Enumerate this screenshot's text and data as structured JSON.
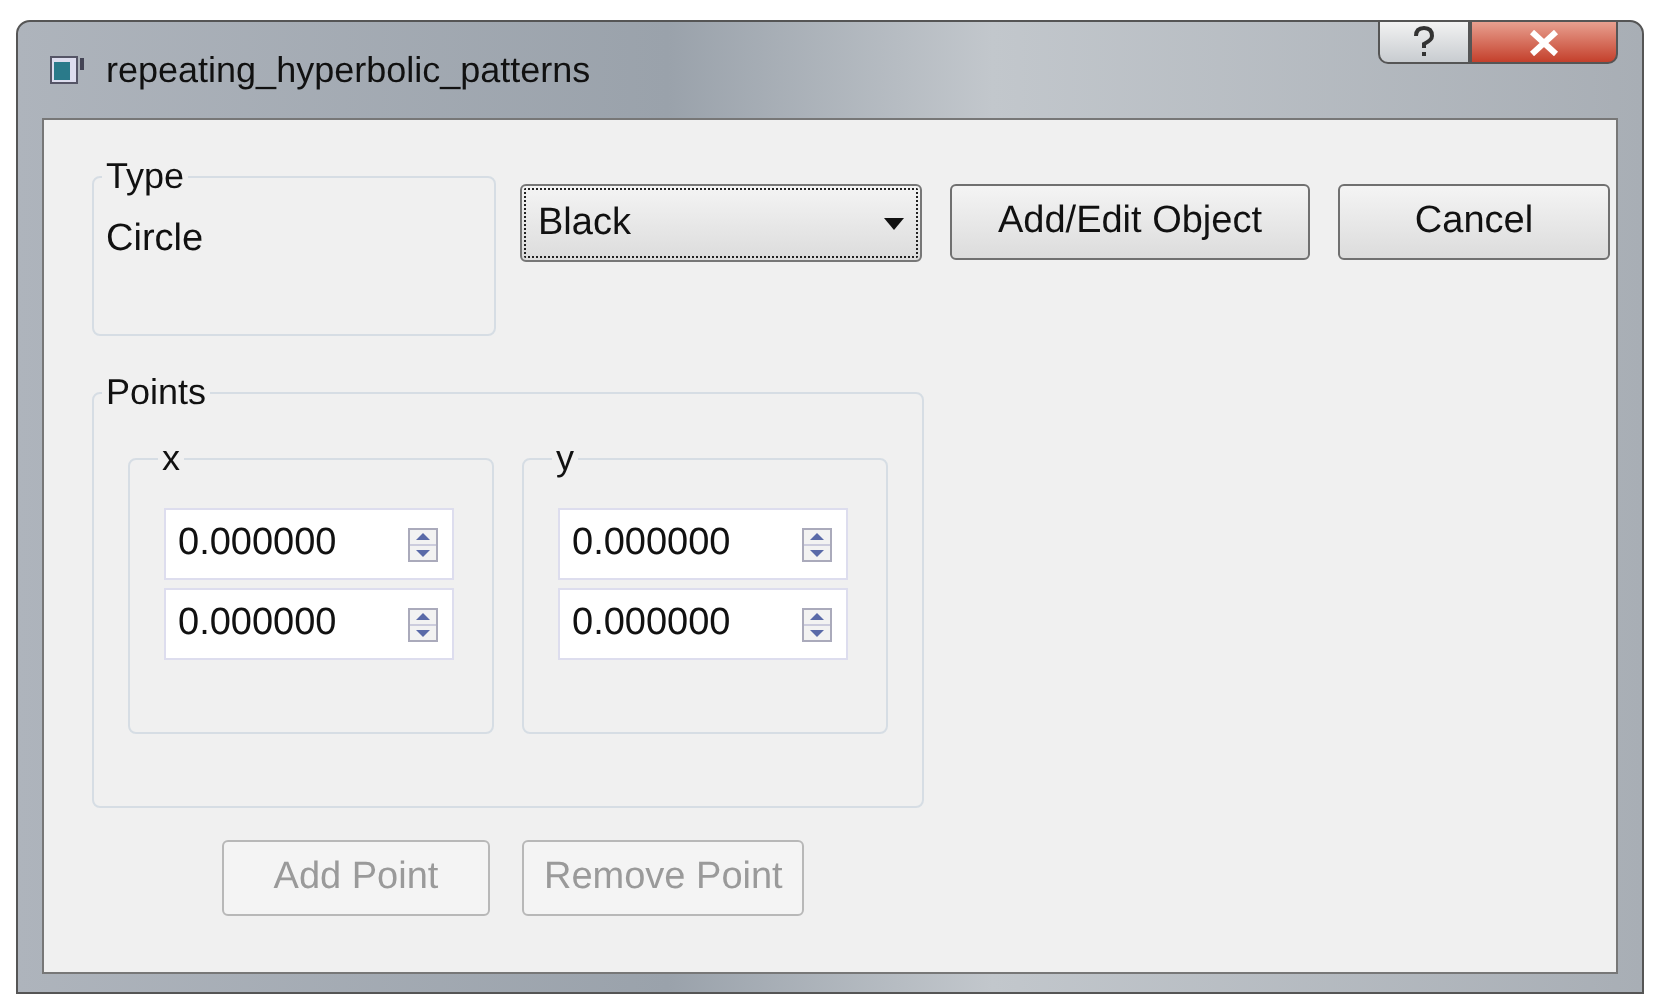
{
  "window": {
    "title": "repeating_hyperbolic_patterns"
  },
  "type_group": {
    "title": "Type",
    "value": "Circle"
  },
  "color_dropdown": {
    "value": "Black",
    "focused": true
  },
  "buttons": [
    {
      "label": "Add/Edit Object",
      "disabled": false
    },
    {
      "label": "Cancel",
      "disabled": false
    }
  ],
  "points_group": {
    "title": "Points",
    "columns": [
      {
        "title": "x",
        "values": [
          "0.000000",
          "0.000000"
        ]
      },
      {
        "title": "y",
        "values": [
          "0.000000",
          "0.000000"
        ]
      }
    ]
  },
  "point_buttons": [
    {
      "label": "Add Point",
      "disabled": true
    },
    {
      "label": "Remove Point",
      "disabled": true
    }
  ]
}
